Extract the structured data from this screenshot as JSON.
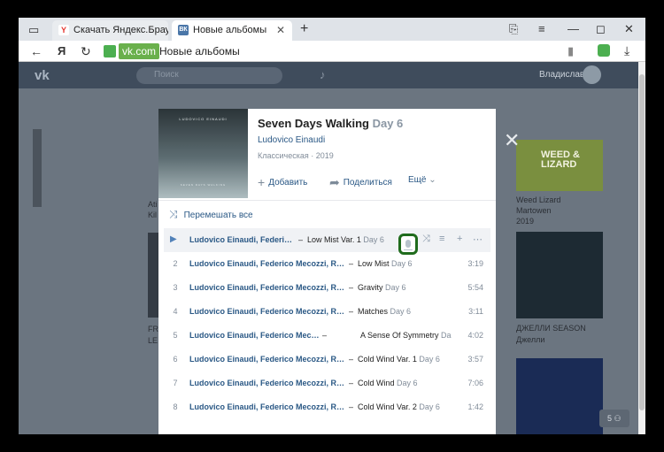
{
  "browser": {
    "tabs": [
      {
        "favicon": "Y",
        "label": "Скачать Яндекс.Браузер д",
        "active": false
      },
      {
        "favicon": "ВК",
        "label": "Новые альбомы",
        "active": true
      }
    ],
    "address": {
      "host": "vk.com",
      "page_title": "Новые альбомы",
      "back_label": "←",
      "yandex_label": "Я",
      "reload_label": "↻"
    }
  },
  "vk": {
    "search_placeholder": "Поиск",
    "user_name": "Владислав",
    "player_count": "0",
    "background_labels": {
      "weed_title": "WEED & LIZARD",
      "weed_caption": "Weed Lizard",
      "weed_artist": "Martowen",
      "weed_year": "2019",
      "jelly_caption": "ДЖЕЛЛИ SEASON",
      "jelly_artist": "Джелли",
      "left1": "Ati",
      "left2": "Kil",
      "left3": "FR",
      "left4": "LE"
    },
    "pager": "5"
  },
  "album": {
    "cover_artist": "LUDOVICO EINAUDI",
    "cover_title": "SEVEN DAYS WALKING",
    "title": "Seven Days Walking",
    "day": "Day 6",
    "artist": "Ludovico Einaudi",
    "genre": "Классическая",
    "year": "2019",
    "add_label": "Добавить",
    "share_label": "Поделиться",
    "more_label": "Ещё",
    "shuffle_label": "Перемешать все",
    "close_label": "✕"
  },
  "tracks": [
    {
      "num": "1",
      "artists": "Ludovico Einaudi, Federico Me...",
      "title": "Low Mist Var. 1",
      "day": "Day 6",
      "duration": ""
    },
    {
      "num": "2",
      "artists": "Ludovico Einaudi, Federico Mecozzi, Redi Hasa",
      "title": "Low Mist",
      "day": "Day 6",
      "duration": "3:19"
    },
    {
      "num": "3",
      "artists": "Ludovico Einaudi, Federico Mecozzi, Redi Hasa",
      "title": "Gravity",
      "day": "Day 6",
      "duration": "5:54"
    },
    {
      "num": "4",
      "artists": "Ludovico Einaudi, Federico Mecozzi, Redi Hasa",
      "title": "Matches",
      "day": "Day 6",
      "duration": "3:11"
    },
    {
      "num": "5",
      "artists": "Ludovico Einaudi, Federico Mecozzi, Redi H...",
      "title": "A Sense Of Symmetry",
      "day": "Da",
      "duration": "4:02"
    },
    {
      "num": "6",
      "artists": "Ludovico Einaudi, Federico Mecozzi, Redi Hasa",
      "title": "Cold Wind Var. 1",
      "day": "Day 6",
      "duration": "3:57"
    },
    {
      "num": "7",
      "artists": "Ludovico Einaudi, Federico Mecozzi, Redi Hasa",
      "title": "Cold Wind",
      "day": "Day 6",
      "duration": "7:06"
    },
    {
      "num": "8",
      "artists": "Ludovico Einaudi, Federico Mecozzi, Redi Hasa",
      "title": "Cold Wind Var. 2",
      "day": "Day 6",
      "duration": "1:42"
    }
  ]
}
